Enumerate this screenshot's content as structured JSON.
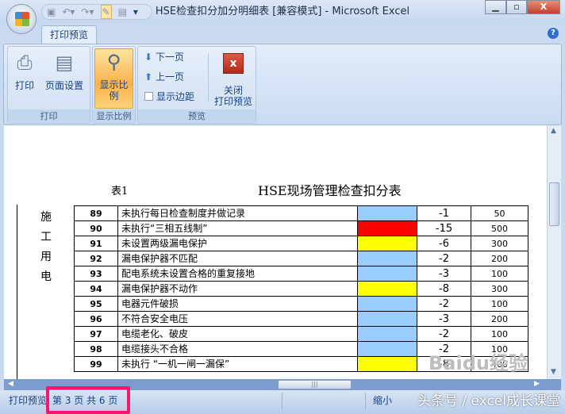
{
  "window": {
    "title": "HSE检查扣分加分明细表  [兼容模式] - Microsoft Excel",
    "minimize": "▭",
    "restore": "⧉",
    "close": "X"
  },
  "qat": {
    "save": "💾",
    "undo": "↶",
    "redo": "↷",
    "icons": [
      "save-icon",
      "undo-icon",
      "redo-icon",
      "tools-icon",
      "form-icon",
      "customize-icon"
    ]
  },
  "tabs": [
    {
      "label": "打印预览"
    }
  ],
  "help": "?",
  "ribbon": {
    "groups": [
      {
        "label": "打印",
        "buttons": [
          "打印",
          "页面设置"
        ]
      },
      {
        "label": "显示比例",
        "buttons": [
          "显示比例"
        ]
      },
      {
        "label": "预览",
        "buttons": [
          "下一页",
          "上一页",
          "显示边距"
        ],
        "close_line1": "关闭",
        "close_line2": "打印预览"
      }
    ],
    "show_margins_checked": false
  },
  "page": {
    "table_label": "表1",
    "title": "HSE现场管理检查扣分表",
    "category": [
      "施",
      "工",
      "用",
      "电"
    ],
    "rows": [
      {
        "no": "89",
        "desc": "未执行每日检查制度并做记录",
        "color": "#99ccff",
        "score": "-1",
        "amount": "50"
      },
      {
        "no": "90",
        "desc": "未执行“三相五线制”",
        "color": "#ff0000",
        "score": "-15",
        "amount": "500"
      },
      {
        "no": "91",
        "desc": "未设置两级漏电保护",
        "color": "#ffff00",
        "score": "-6",
        "amount": "300"
      },
      {
        "no": "92",
        "desc": "漏电保护器不匹配",
        "color": "#99ccff",
        "score": "-2",
        "amount": "200"
      },
      {
        "no": "93",
        "desc": "配电系统未设置合格的重复接地",
        "color": "#99ccff",
        "score": "-3",
        "amount": "100"
      },
      {
        "no": "94",
        "desc": "漏电保护器不动作",
        "color": "#ffff00",
        "score": "-8",
        "amount": "300"
      },
      {
        "no": "95",
        "desc": "电器元件破损",
        "color": "#99ccff",
        "score": "-2",
        "amount": "100"
      },
      {
        "no": "96",
        "desc": "不符合安全电压",
        "color": "#99ccff",
        "score": "-3",
        "amount": "200"
      },
      {
        "no": "97",
        "desc": "电缆老化、破皮",
        "color": "#99ccff",
        "score": "-2",
        "amount": "100"
      },
      {
        "no": "98",
        "desc": "电缆接头不合格",
        "color": "#99ccff",
        "score": "-2",
        "amount": "100"
      },
      {
        "no": "99",
        "desc": "未执行 “一机一闸一漏保”",
        "color": "#ffff00",
        "score": "-8",
        "amount": "400"
      }
    ]
  },
  "status": {
    "mode": "打印预览",
    "page_info": "第 3 页  共 6 页",
    "zoom_out": "缩小"
  },
  "watermark": {
    "baidu": "Baidu经验",
    "toutiao": "头条号 / excel成长课堂"
  }
}
